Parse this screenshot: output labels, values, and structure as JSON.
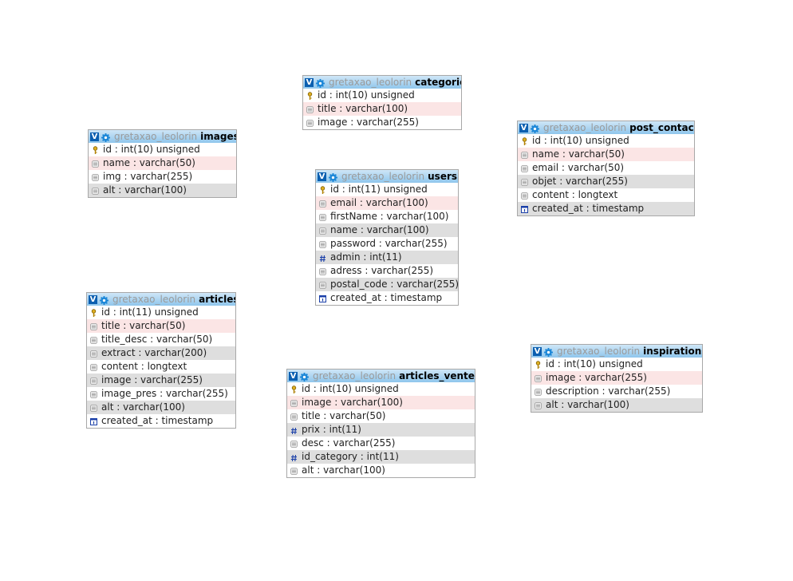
{
  "tables": [
    {
      "id": "categorie",
      "db": "gretaxao_leolorin",
      "name": "categorie",
      "columns": [
        {
          "text": "id : int(10) unsigned",
          "icon": "key-icon",
          "row": "white"
        },
        {
          "text": "title : varchar(100)",
          "icon": "column-icon",
          "row": "pink"
        },
        {
          "text": "image : varchar(255)",
          "icon": "column-icon",
          "row": "white"
        }
      ]
    },
    {
      "id": "images",
      "db": "gretaxao_leolorin",
      "name": "images",
      "columns": [
        {
          "text": "id : int(10) unsigned",
          "icon": "key-icon",
          "row": "white"
        },
        {
          "text": "name : varchar(50)",
          "icon": "column-icon",
          "row": "pink"
        },
        {
          "text": "img : varchar(255)",
          "icon": "column-icon",
          "row": "white"
        },
        {
          "text": "alt : varchar(100)",
          "icon": "column-icon",
          "row": "gray"
        }
      ]
    },
    {
      "id": "post_contact",
      "db": "gretaxao_leolorin",
      "name": "post_contact",
      "columns": [
        {
          "text": "id : int(10) unsigned",
          "icon": "key-icon",
          "row": "white"
        },
        {
          "text": "name : varchar(50)",
          "icon": "column-icon",
          "row": "pink"
        },
        {
          "text": "email : varchar(50)",
          "icon": "column-icon",
          "row": "white"
        },
        {
          "text": "objet : varchar(255)",
          "icon": "column-icon",
          "row": "gray"
        },
        {
          "text": "content : longtext",
          "icon": "column-icon",
          "row": "white"
        },
        {
          "text": "created_at : timestamp",
          "icon": "timestamp-icon",
          "row": "gray"
        }
      ]
    },
    {
      "id": "users",
      "db": "gretaxao_leolorin",
      "name": "users",
      "columns": [
        {
          "text": "id : int(11) unsigned",
          "icon": "key-icon",
          "row": "white"
        },
        {
          "text": "email : varchar(100)",
          "icon": "column-icon",
          "row": "pink"
        },
        {
          "text": "firstName : varchar(100)",
          "icon": "column-icon",
          "row": "white"
        },
        {
          "text": "name : varchar(100)",
          "icon": "column-icon",
          "row": "gray"
        },
        {
          "text": "password : varchar(255)",
          "icon": "column-icon",
          "row": "white"
        },
        {
          "text": "admin : int(11)",
          "icon": "hash-icon",
          "row": "gray"
        },
        {
          "text": "adress : varchar(255)",
          "icon": "column-icon",
          "row": "white"
        },
        {
          "text": "postal_code : varchar(255)",
          "icon": "column-icon",
          "row": "gray"
        },
        {
          "text": "created_at : timestamp",
          "icon": "timestamp-icon",
          "row": "white"
        }
      ]
    },
    {
      "id": "articles",
      "db": "gretaxao_leolorin",
      "name": "articles",
      "columns": [
        {
          "text": "id : int(11) unsigned",
          "icon": "key-icon",
          "row": "white"
        },
        {
          "text": "title : varchar(50)",
          "icon": "column-icon",
          "row": "pink"
        },
        {
          "text": "title_desc : varchar(50)",
          "icon": "column-icon",
          "row": "white"
        },
        {
          "text": "extract : varchar(200)",
          "icon": "column-icon",
          "row": "gray"
        },
        {
          "text": "content : longtext",
          "icon": "column-icon",
          "row": "white"
        },
        {
          "text": "image : varchar(255)",
          "icon": "column-icon",
          "row": "gray"
        },
        {
          "text": "image_pres : varchar(255)",
          "icon": "column-icon",
          "row": "white"
        },
        {
          "text": "alt : varchar(100)",
          "icon": "column-icon",
          "row": "gray"
        },
        {
          "text": "created_at : timestamp",
          "icon": "timestamp-icon",
          "row": "white"
        }
      ]
    },
    {
      "id": "articles_ventes",
      "db": "gretaxao_leolorin",
      "name": "articles_ventes",
      "columns": [
        {
          "text": "id : int(10) unsigned",
          "icon": "key-icon",
          "row": "white"
        },
        {
          "text": "image : varchar(100)",
          "icon": "column-icon",
          "row": "pink"
        },
        {
          "text": "title : varchar(50)",
          "icon": "column-icon",
          "row": "white"
        },
        {
          "text": "prix : int(11)",
          "icon": "hash-icon",
          "row": "gray"
        },
        {
          "text": "desc : varchar(255)",
          "icon": "column-icon",
          "row": "white"
        },
        {
          "text": "id_category : int(11)",
          "icon": "hash-icon",
          "row": "gray"
        },
        {
          "text": "alt : varchar(100)",
          "icon": "column-icon",
          "row": "white"
        }
      ]
    },
    {
      "id": "inspirations",
      "db": "gretaxao_leolorin",
      "name": "inspirations",
      "columns": [
        {
          "text": "id : int(10) unsigned",
          "icon": "key-icon",
          "row": "white"
        },
        {
          "text": "image : varchar(255)",
          "icon": "column-icon",
          "row": "pink"
        },
        {
          "text": "description : varchar(255)",
          "icon": "column-icon",
          "row": "white"
        },
        {
          "text": "alt : varchar(100)",
          "icon": "column-icon",
          "row": "gray"
        }
      ]
    }
  ],
  "toggle_glyph": "V"
}
